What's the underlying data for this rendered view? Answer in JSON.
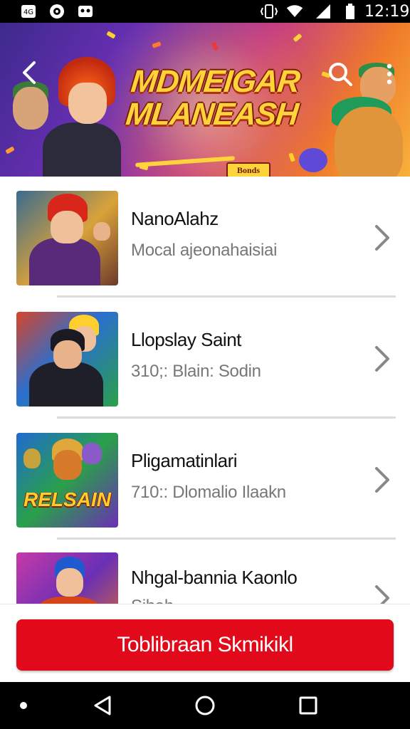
{
  "status_bar": {
    "time": "12:19",
    "left_icons": [
      "notification-4g-icon",
      "world-app-icon",
      "cassette-icon"
    ],
    "right_icons": [
      "vibrate-icon",
      "wifi-icon",
      "signal-icon",
      "battery-icon"
    ]
  },
  "banner": {
    "title_line1": "MDMEIGAR",
    "title_line2": "MLANEASH",
    "badge": "Bonds",
    "back_icon": "back-arrow-icon",
    "search_icon": "search-icon",
    "more_icon": "more-vert-icon"
  },
  "list": {
    "items": [
      {
        "title": "NanoAlahz",
        "subtitle": "Mocal ajeonahaisiai"
      },
      {
        "title": "Llopslay Saint",
        "subtitle": "310;: Blain: Sodin"
      },
      {
        "title": "Pligamatinlari",
        "subtitle": "710:: Dlomalio Ilaakn"
      },
      {
        "title": "Nhgal-bannia Kaonlo",
        "subtitle": "Sihah..."
      }
    ],
    "thumb_logo_text": "RELSAIN"
  },
  "cta": {
    "label": "Toblibraan Skmikikl"
  },
  "nav_bar": {
    "icons": [
      "back-triangle-icon",
      "home-circle-icon",
      "recents-square-icon"
    ]
  },
  "colors": {
    "accent": "#e20a1a",
    "banner_title": "#ffd43b"
  }
}
